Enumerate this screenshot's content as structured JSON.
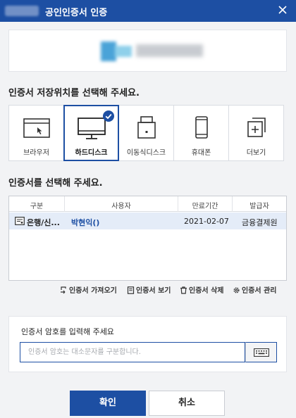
{
  "title": {
    "text": "공인인증서 인증"
  },
  "sections": {
    "storage_label": "인증서 저장위치를 선택해 주세요.",
    "cert_label": "인증서를 선택해 주세요.",
    "password_label": "인증서 암호를 입력해 주세요"
  },
  "storage": [
    {
      "label": "브라우저",
      "icon": "browser-window-icon",
      "selected": false
    },
    {
      "label": "하드디스크",
      "icon": "monitor-icon",
      "selected": true
    },
    {
      "label": "이동식디스크",
      "icon": "usb-drive-icon",
      "selected": false
    },
    {
      "label": "휴대폰",
      "icon": "mobile-phone-icon",
      "selected": false
    },
    {
      "label": "더보기",
      "icon": "more-plus-icon",
      "selected": false
    }
  ],
  "table": {
    "headers": [
      "구분",
      "사용자",
      "만료기간",
      "발급자"
    ],
    "rows": [
      {
        "type": "은행/신...",
        "user": "박현익()",
        "expiry": "2021-02-07",
        "issuer": "금융결제원"
      }
    ]
  },
  "actions": {
    "import": "인증서 가져오기",
    "view": "인증서 보기",
    "delete": "인증서 삭제",
    "manage": "인증서 관리"
  },
  "password": {
    "placeholder": "인증서 암호는 대소문자를 구분합니다.",
    "value": ""
  },
  "buttons": {
    "ok": "확인",
    "cancel": "취소"
  },
  "colors": {
    "primary": "#1d4fa3",
    "selected_row": "#e4ecf8",
    "background": "#f2f3f5"
  }
}
